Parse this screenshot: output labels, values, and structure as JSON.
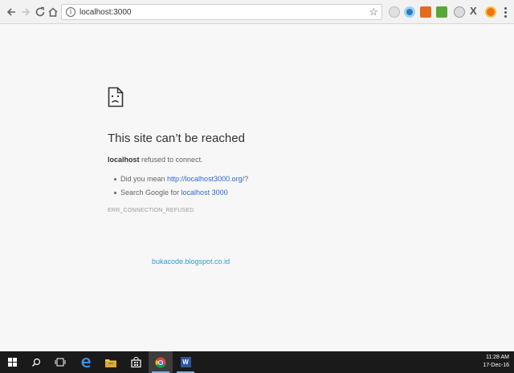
{
  "browser": {
    "url": "localhost:3000",
    "extensions": [
      "circle-ext-icon",
      "globe-ext-icon",
      "download-ext-icon",
      "android-ext-icon",
      "ball-ext-icon",
      "x-ext-icon",
      "fire-ext-icon"
    ],
    "x_label": "X"
  },
  "error_page": {
    "title": "This site can’t be reached",
    "host": "localhost",
    "desc_suffix": " refused to connect.",
    "suggestion1_prefix": "Did you mean ",
    "suggestion1_link": "http://localhost3000.org/",
    "suggestion1_suffix": "?",
    "suggestion2_prefix": "Search Google for ",
    "suggestion2_link": "localhost 3000",
    "error_code": "ERR_CONNECTION_REFUSED"
  },
  "watermark": "bukacode.blogspot.co.id",
  "taskbar": {
    "time": "11:28 AM",
    "date": "17-Dec-16",
    "word_label": "W"
  },
  "colors": {
    "link": "#3367d6",
    "watermark": "#24a0d6",
    "taskbar": "#1a1a1a"
  }
}
